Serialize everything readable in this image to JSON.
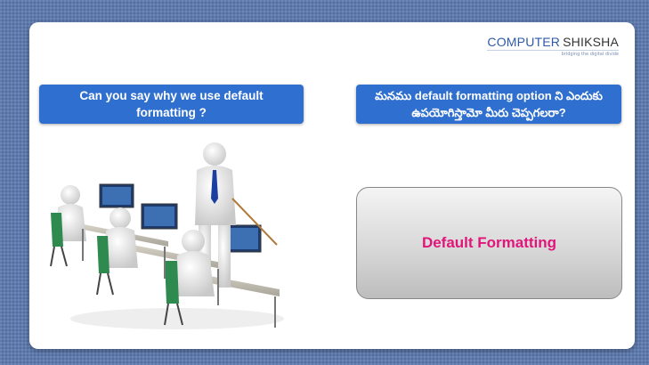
{
  "logo": {
    "brand_first": "COMPUTER",
    "brand_second": "SHIKSHA",
    "tagline": "bridging the digital divide"
  },
  "questions": {
    "english": "Can you say why we use default formatting ?",
    "telugu": "మనము default formatting option ని ఎందుకు ఉపయోగిస్తామో మీరు చెప్పగలరా?"
  },
  "answer": {
    "text": "Default Formatting"
  },
  "colors": {
    "question_box": "#2f6fcf",
    "answer_text": "#e0157a",
    "background": "#5b79b0"
  },
  "illustration": {
    "icon": "classroom-computers-illustration"
  }
}
